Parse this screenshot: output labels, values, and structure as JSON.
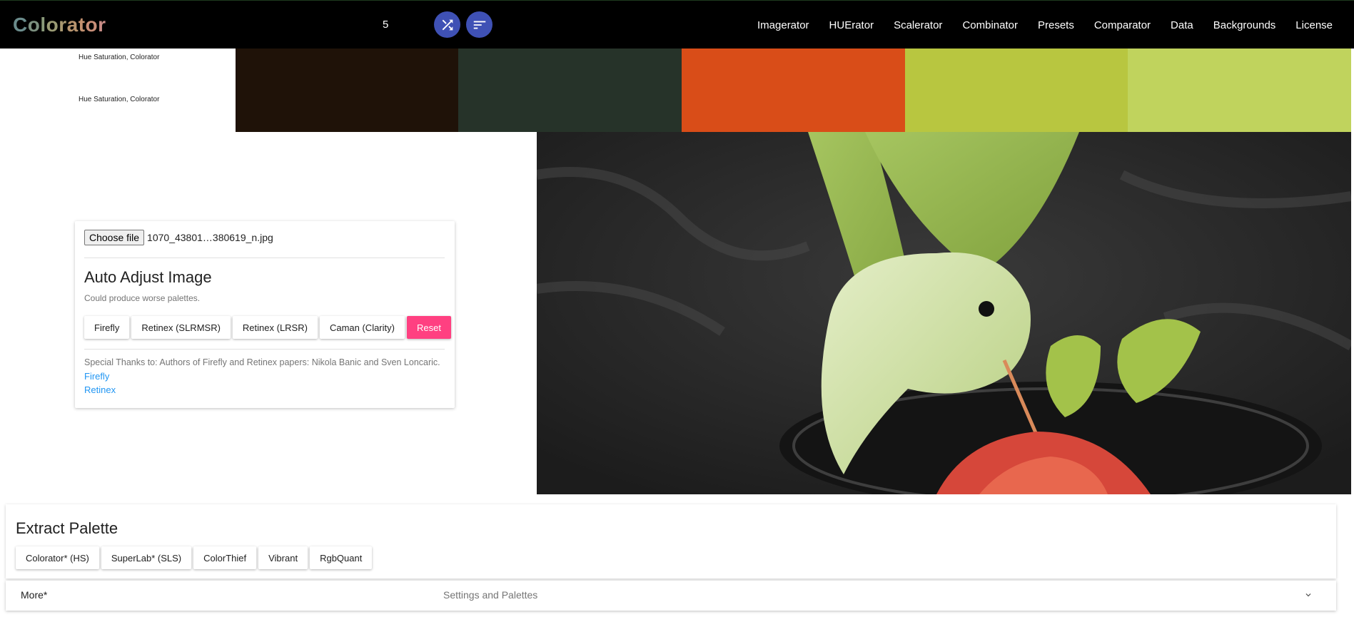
{
  "header": {
    "logo_letters": [
      "C",
      "o",
      "l",
      "o",
      "r",
      "a",
      "t",
      "o",
      "r"
    ],
    "count_value": "5",
    "shuffle_icon": "shuffle-icon",
    "sort_icon": "sort-icon",
    "nav": [
      "Imagerator",
      "HUErator",
      "Scalerator",
      "Combinator",
      "Presets",
      "Comparator",
      "Data",
      "Backgrounds",
      "License"
    ]
  },
  "swatches": {
    "labels": [
      "Hue Saturation, Colorator",
      "Hue Saturation, Colorator"
    ],
    "colors": [
      "#1f1208",
      "#263329",
      "#d94d18",
      "#b8c640",
      "#c0d35d"
    ]
  },
  "auto_adjust": {
    "choose_file_label": "Choose file",
    "file_name": "1070_43801…380619_n.jpg",
    "title": "Auto Adjust Image",
    "subtitle": "Could produce worse palettes.",
    "buttons": [
      "Firefly",
      "Retinex (SLRMSR)",
      "Retinex (LRSR)",
      "Caman (Clarity)"
    ],
    "reset_label": "Reset",
    "thanks": "Special Thanks to: Authors of Firefly and Retinex papers: Nikola Banic and Sven Loncaric.",
    "link_firefly": "Firefly",
    "link_retinex": "Retinex"
  },
  "extract": {
    "title": "Extract Palette",
    "buttons": [
      "Colorator* (HS)",
      "SuperLab* (SLS)",
      "ColorThief",
      "Vibrant",
      "RgbQuant"
    ]
  },
  "more": {
    "label": "More*",
    "sub": "Settings and Palettes",
    "chevron_icon": "chevron-down-icon"
  },
  "colors": {
    "accent_blue": "#3f51b5",
    "reset_pink": "#ff4081",
    "link_blue": "#2196f3"
  }
}
